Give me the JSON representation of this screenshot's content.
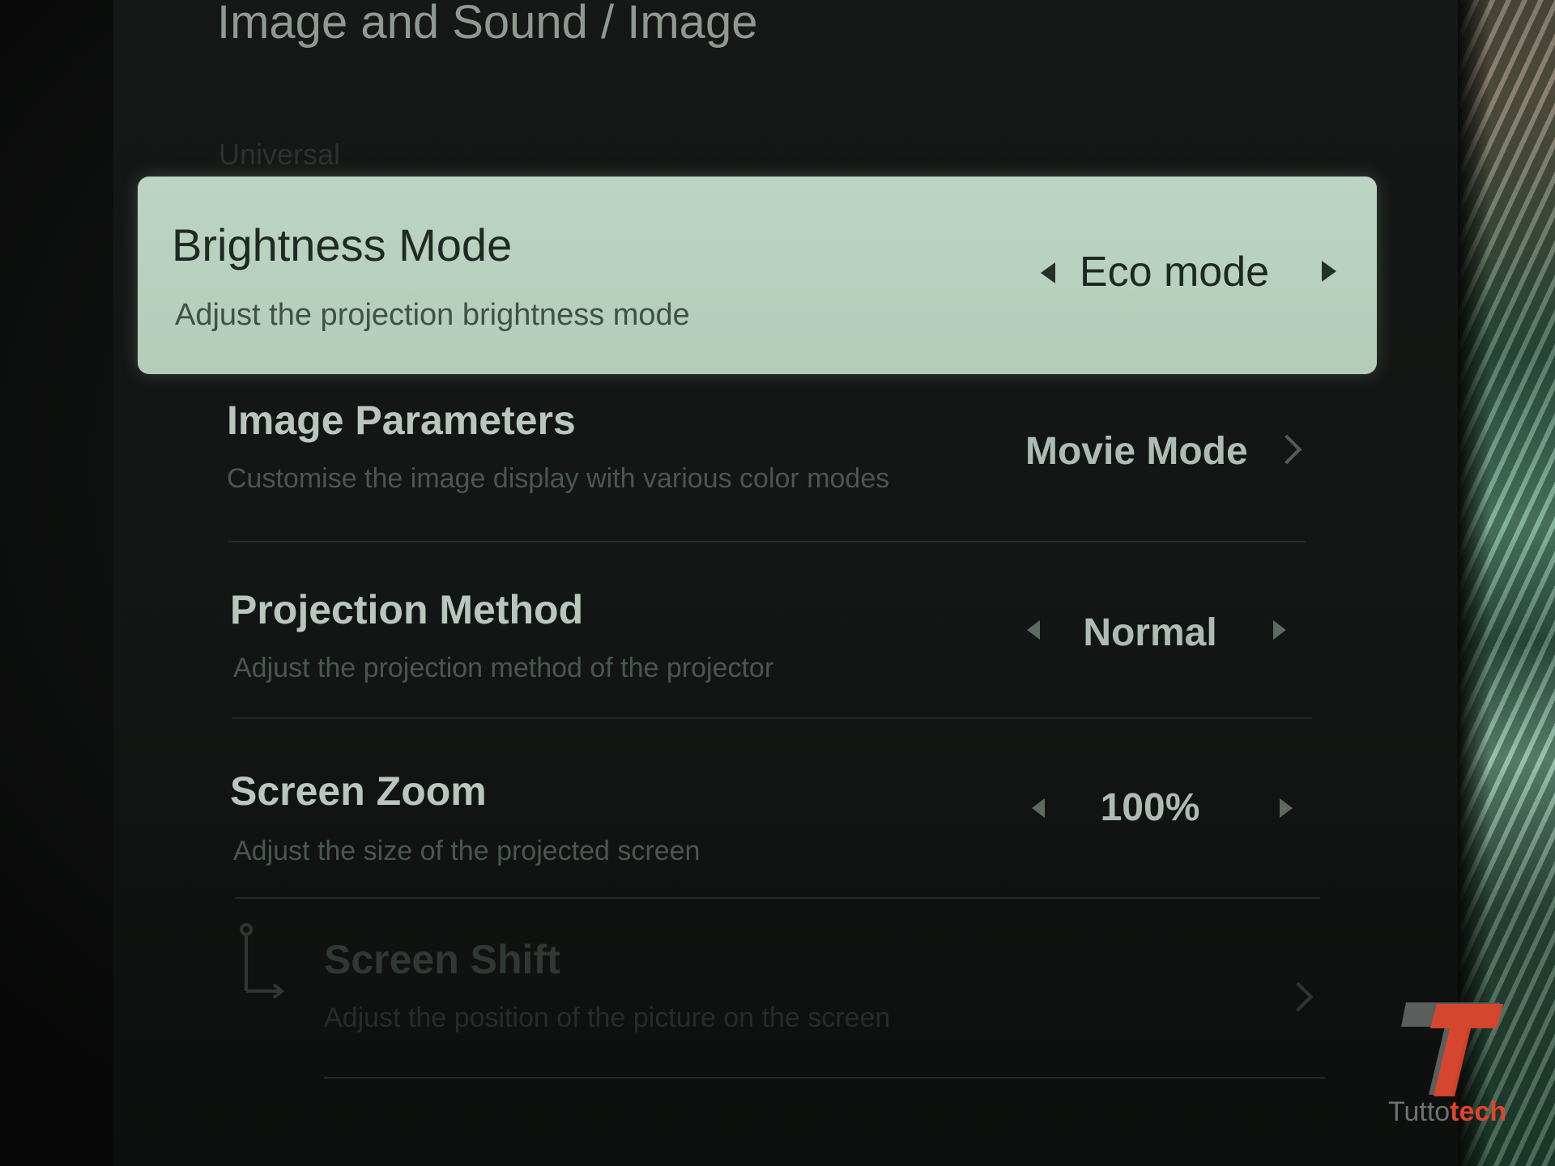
{
  "header": {
    "breadcrumb": "Image and Sound / Image",
    "section": "Universal"
  },
  "settings": [
    {
      "title": "Brightness Mode",
      "description": "Adjust the projection brightness mode",
      "value": "Eco mode",
      "control": "selector",
      "focused": true
    },
    {
      "title": "Image Parameters",
      "description": "Customise the image display with various color modes",
      "value": "Movie Mode",
      "control": "submenu"
    },
    {
      "title": "Projection Method",
      "description": "Adjust the projection method of the projector",
      "value": "Normal",
      "control": "selector"
    },
    {
      "title": "Screen Zoom",
      "description": "Adjust the size of the projected screen",
      "value": "100%",
      "control": "selector"
    },
    {
      "title": "Screen Shift",
      "description": "Adjust the position of the picture on the screen",
      "control": "submenu",
      "disabled": true,
      "icon": "screen-shift-icon"
    }
  ],
  "watermark": {
    "brand_prefix": "Tutto",
    "brand_suffix": "tech",
    "logo_icon": "tuttotech-t-logo",
    "colors": {
      "logo_red": "#e1442a",
      "logo_gray": "#5a5e5c"
    }
  },
  "colors": {
    "focused_row_bg": "#b8d0bf",
    "background": "#121513",
    "text_primary": "#b9c6bd",
    "text_muted": "#4a574f"
  }
}
